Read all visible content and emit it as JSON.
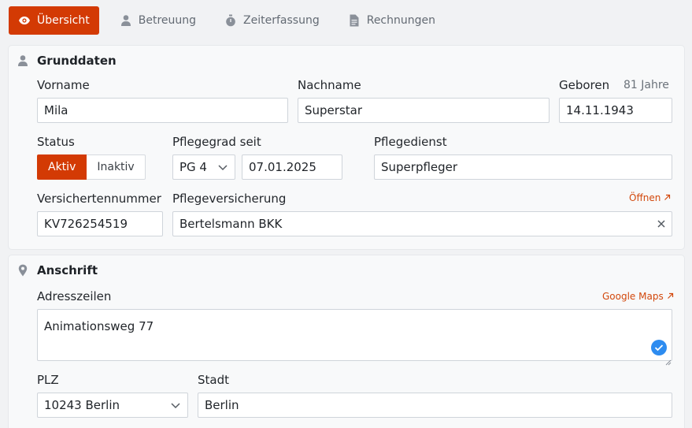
{
  "tabs": [
    {
      "label": "Übersicht",
      "icon": "eye-icon",
      "active": true
    },
    {
      "label": "Betreuung",
      "icon": "person-icon",
      "active": false
    },
    {
      "label": "Zeiterfassung",
      "icon": "stopwatch-icon",
      "active": false
    },
    {
      "label": "Rechnungen",
      "icon": "document-icon",
      "active": false
    }
  ],
  "colors": {
    "accent": "#d33a04",
    "link": "#d2480c",
    "check": "#2d8cf0"
  },
  "grunddaten": {
    "title": "Grunddaten",
    "vorname": {
      "label": "Vorname",
      "value": "Mila"
    },
    "nachname": {
      "label": "Nachname",
      "value": "Superstar"
    },
    "geboren": {
      "label": "Geboren",
      "age": "81 Jahre",
      "value": "14.11.1943"
    },
    "status": {
      "label": "Status",
      "options": [
        "Aktiv",
        "Inaktiv"
      ],
      "selected": "Aktiv"
    },
    "pflegegrad": {
      "label": "Pflegegrad seit",
      "grade": "PG 4",
      "date": "07.01.2025"
    },
    "pflegedienst": {
      "label": "Pflegedienst",
      "value": "Superpfleger"
    },
    "versichertennummer": {
      "label": "Versichertennummer",
      "value": "KV726254519"
    },
    "pflegeversicherung": {
      "label": "Pflegeversicherung",
      "value": "Bertelsmann BKK",
      "link": "Öffnen"
    }
  },
  "anschrift": {
    "title": "Anschrift",
    "adresszeilen": {
      "label": "Adresszeilen",
      "value": "Animationsweg 77",
      "link": "Google Maps"
    },
    "plz": {
      "label": "PLZ",
      "value": "10243 Berlin"
    },
    "stadt": {
      "label": "Stadt",
      "value": "Berlin"
    }
  }
}
